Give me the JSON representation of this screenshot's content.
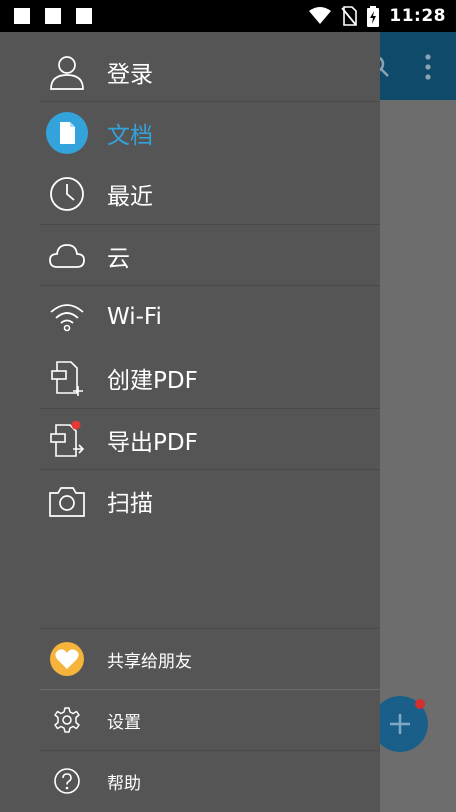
{
  "status_bar": {
    "time": "11:28",
    "icons": [
      "notification-square",
      "notification-square",
      "notification-square",
      "wifi-icon",
      "no-sim-icon",
      "battery-charging-icon"
    ]
  },
  "drawer": {
    "items": [
      {
        "label": "登录",
        "icon": "user-icon"
      },
      {
        "label": "文档",
        "icon": "document-icon",
        "active": true
      },
      {
        "label": "最近",
        "icon": "clock-icon"
      },
      {
        "label": "云",
        "icon": "cloud-icon"
      },
      {
        "label": "Wi-Fi",
        "icon": "wifi-icon"
      },
      {
        "label": "创建PDF",
        "icon": "create-pdf-icon"
      },
      {
        "label": "导出PDF",
        "icon": "export-pdf-icon"
      },
      {
        "label": "扫描",
        "icon": "camera-icon"
      }
    ],
    "footer": [
      {
        "label": "共享给朋友",
        "icon": "heart-icon"
      },
      {
        "label": "设置",
        "icon": "gear-icon"
      },
      {
        "label": "帮助",
        "icon": "help-icon"
      }
    ]
  },
  "colors": {
    "drawer_bg": "#555555",
    "accent": "#34a3dc",
    "heart_badge": "#f6b43a",
    "notification_dot": "#e53935",
    "toolbar": "#0f4a6b"
  }
}
